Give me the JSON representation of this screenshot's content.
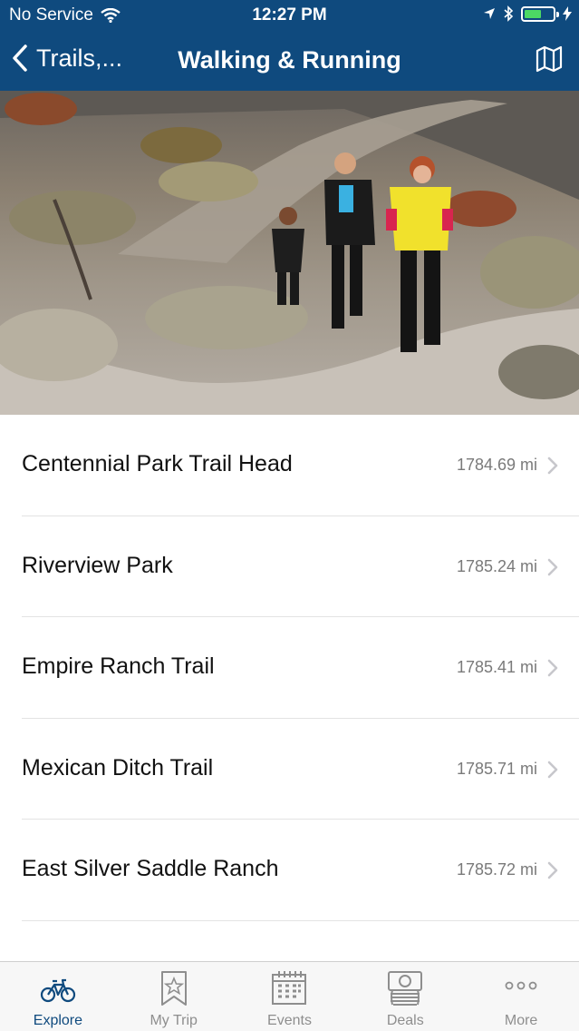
{
  "status_bar": {
    "carrier": "No Service",
    "time": "12:27 PM",
    "battery_level": 0.6
  },
  "nav": {
    "back_label": "Trails,...",
    "title": "Walking & Running",
    "map_icon": "map-icon"
  },
  "trails": [
    {
      "name": "Centennial Park Trail Head",
      "distance": "1784.69 mi"
    },
    {
      "name": "Riverview Park",
      "distance": "1785.24 mi"
    },
    {
      "name": "Empire Ranch Trail",
      "distance": "1785.41 mi"
    },
    {
      "name": "Mexican Ditch Trail",
      "distance": "1785.71 mi"
    },
    {
      "name": "East Silver Saddle Ranch",
      "distance": "1785.72 mi"
    }
  ],
  "tabs": [
    {
      "label": "Explore",
      "icon": "bicycle-icon",
      "active": true
    },
    {
      "label": "My Trip",
      "icon": "bookmark-star-icon",
      "active": false
    },
    {
      "label": "Events",
      "icon": "calendar-icon",
      "active": false
    },
    {
      "label": "Deals",
      "icon": "money-icon",
      "active": false
    },
    {
      "label": "More",
      "icon": "more-dots-icon",
      "active": false
    }
  ],
  "colors": {
    "header": "#0f4a7e",
    "accent": "#0f4a7e",
    "tab_inactive": "#8e8e8e",
    "battery": "#4cd964"
  }
}
